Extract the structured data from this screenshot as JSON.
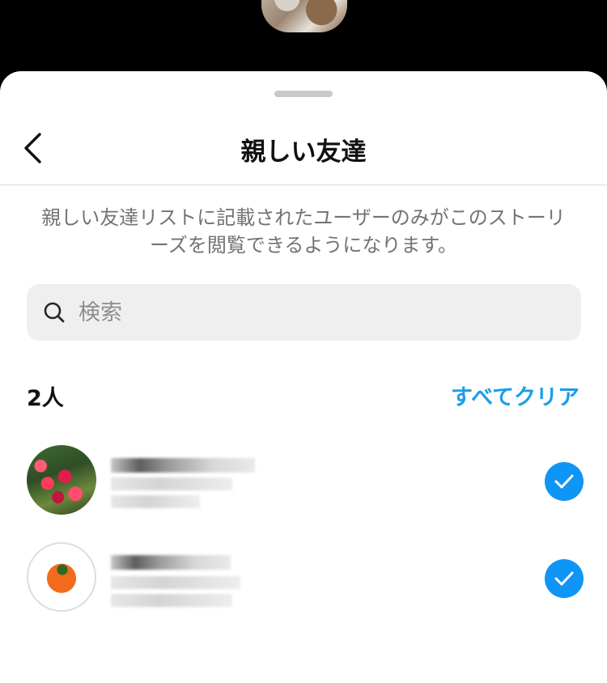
{
  "header": {
    "title": "親しい友達",
    "back_icon": "chevron-left-icon"
  },
  "description": "親しい友達リストに記載されたユーザーのみがこのストーリーズを閲覧できるようになります。",
  "search": {
    "placeholder": "検索",
    "value": "",
    "icon": "search-icon"
  },
  "list": {
    "count_label": "2人",
    "clear_all_label": "すべてクリア",
    "accent_color": "#0f95f6",
    "items": [
      {
        "avatar": "red-flowers-photo",
        "selected": true
      },
      {
        "avatar": "tomato-photo",
        "selected": true
      }
    ]
  }
}
